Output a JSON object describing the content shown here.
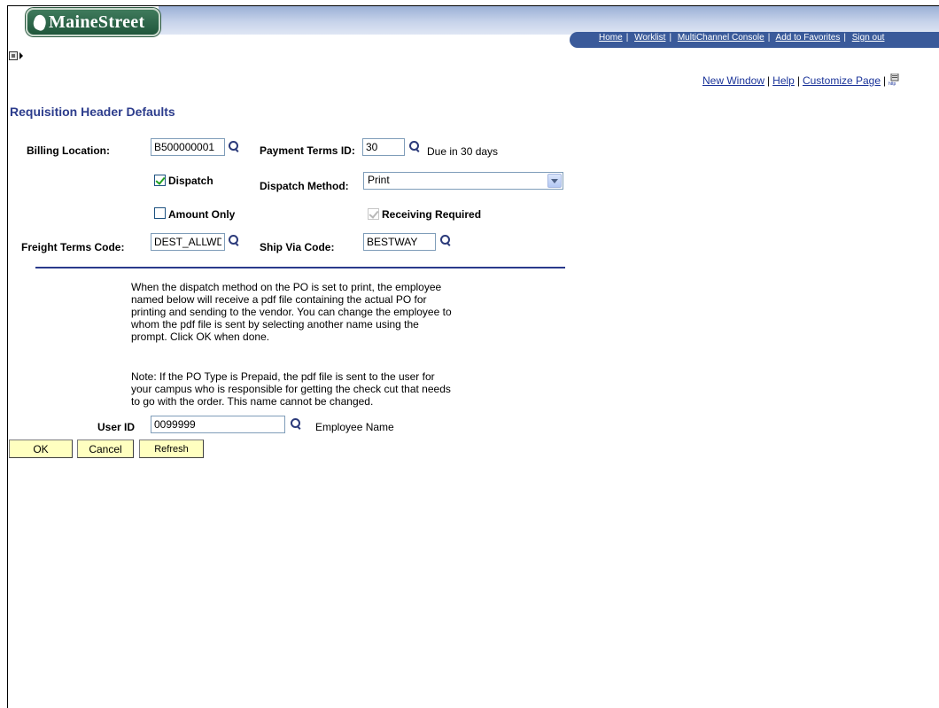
{
  "header": {
    "logo_text": "MaineStreet",
    "nav_links": [
      "Home",
      "Worklist",
      "MultiChannel Console",
      "Add to Favorites",
      "Sign out"
    ]
  },
  "toplinks": {
    "new_window": "New Window",
    "help": "Help",
    "customize_page": "Customize Page"
  },
  "page_title": "Requisition Header Defaults",
  "form": {
    "billing_location_label": "Billing Location:",
    "billing_location_value": "B500000001",
    "payment_terms_label": "Payment Terms ID:",
    "payment_terms_value": "30",
    "payment_terms_desc": "Due in 30 days",
    "dispatch_label": "Dispatch",
    "dispatch_checked": true,
    "dispatch_method_label": "Dispatch Method:",
    "dispatch_method_value": "Print",
    "amount_only_label": "Amount Only",
    "amount_only_checked": false,
    "receiving_required_label": "Receiving Required",
    "receiving_required_checked": true,
    "freight_terms_label": "Freight Terms Code:",
    "freight_terms_value": "DEST_ALLWD",
    "ship_via_label": "Ship Via Code:",
    "ship_via_value": "BESTWAY"
  },
  "info": {
    "line1": "When the dispatch method on the PO is set to print, the employee",
    "line2": "named below will receive a pdf file containing the actual PO for",
    "line3": "printing and sending to the vendor. You can change the employee to",
    "line4": "whom the pdf file is sent by selecting another name using the",
    "line5": "prompt. Click OK when done.",
    "note1": "Note: If the PO Type is Prepaid, the pdf file is sent to the user for",
    "note2": "your campus who is responsible for getting the check cut that needs",
    "note3": "to go with the order. This name cannot be changed."
  },
  "user": {
    "label": "User ID",
    "value": "0099999",
    "employee_name_label": "Employee Name"
  },
  "buttons": {
    "ok": "OK",
    "cancel": "Cancel",
    "refresh": "Refresh"
  },
  "colors": {
    "title": "#2c3c8c",
    "link": "#1a3399",
    "button_bg": "#ffffc0",
    "nav_bar": "#3a5a9a"
  }
}
